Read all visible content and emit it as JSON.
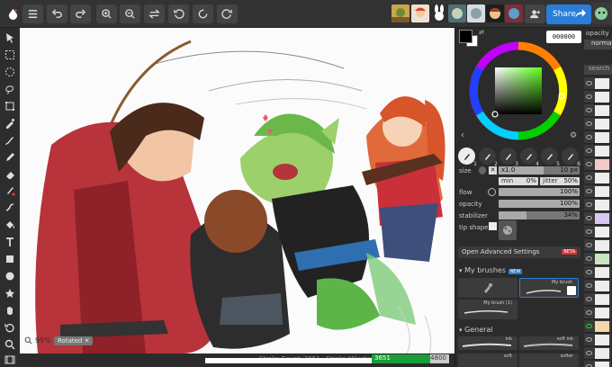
{
  "toolbar": {
    "share_label": "Share",
    "buttons": [
      "menu-icon",
      "undo-icon",
      "redo-icon",
      "zoom-in-icon",
      "zoom-out-icon",
      "swap-icon",
      "rotate-left-icon",
      "reset-rotation-icon",
      "rotate-right-icon"
    ]
  },
  "canvas": {
    "zoom": "95%",
    "rotated_label": "Rotated",
    "status_text": "Stroke Count: 3651 · Stroke Milestone:",
    "stroke_count": "3651",
    "stroke_milestone": "4800",
    "stroke_progress": 0.76
  },
  "color": {
    "hex": "000000",
    "primary": "#000000",
    "secondary": "#ffffff"
  },
  "brush": {
    "size_label": "size",
    "size_mode": "x1.0",
    "size_value": "10 px",
    "size_fraction": 0.55,
    "min_label": "min",
    "min_value": "0%",
    "jitter_label": "jitter",
    "jitter_value": "50%",
    "flow_label": "flow",
    "flow_value": "100%",
    "flow_fraction": 1.0,
    "opacity_label": "opacity",
    "opacity_value": "100%",
    "opacity_fraction": 1.0,
    "stabilizer_label": "stabilizer",
    "stabilizer_value": "34%",
    "stabilizer_fraction": 0.34,
    "tip_shape_label": "tip shape",
    "advanced_label": "Open Advanced Settings",
    "beta_label": "BETA",
    "presets": [
      "1",
      "2",
      "3",
      "4",
      "5",
      "6"
    ]
  },
  "brushes": {
    "section_my": "My brushes",
    "new_badge": "NEW",
    "my_brush_label": "My brush",
    "my_brush_1_label": "My brush (1)",
    "section_general": "General",
    "general_items": [
      "ink",
      "soft ink",
      "soft",
      "softer"
    ]
  },
  "layers": {
    "opacity_label": "opacity",
    "blend_mode": "norma",
    "search_placeholder": "search"
  }
}
